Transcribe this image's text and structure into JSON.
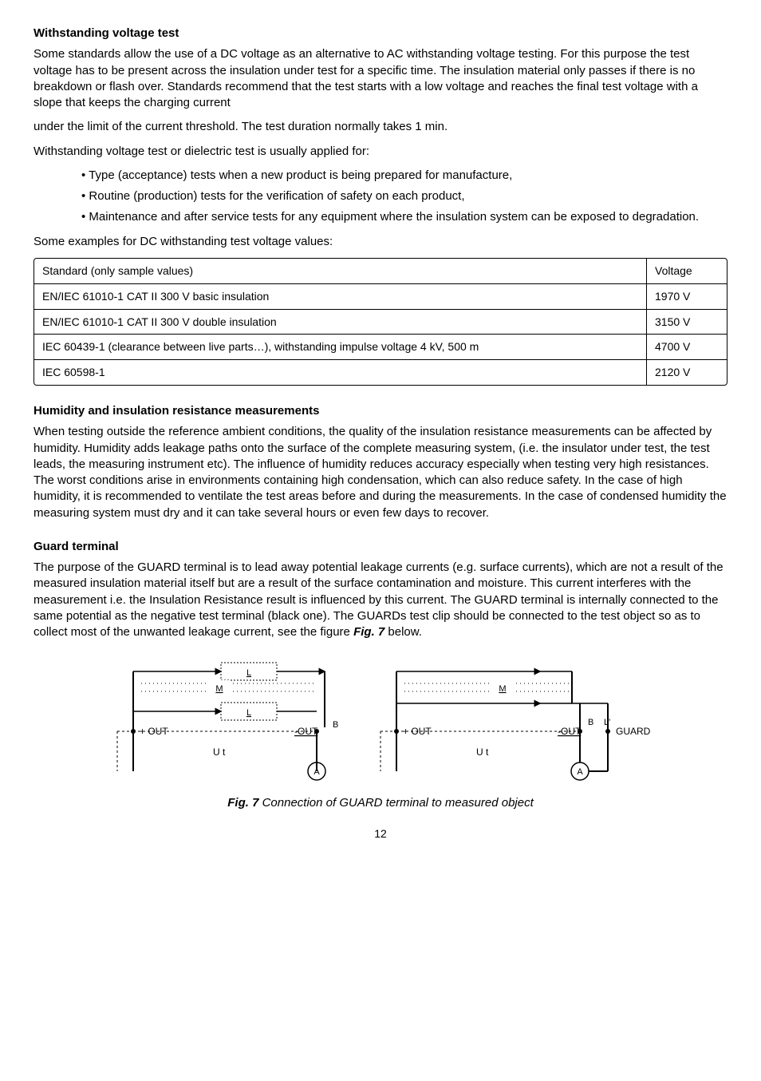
{
  "section1": {
    "heading": "Withstanding voltage test",
    "p1": "Some standards allow the use of a DC voltage as an alternative to AC withstanding voltage testing. For this purpose the test voltage has to be present across the insulation under test for a specific time. The insulation material only passes if there is no breakdown or flash over. Standards recommend that the test starts with a low voltage and reaches the final test voltage with a slope that keeps the charging current",
    "p2": "under the limit of the current threshold. The test duration normally takes 1 min.",
    "p3": "Withstanding voltage test or dielectric test is usually applied for:",
    "bullets": [
      "Type (acceptance) tests when a new product is being prepared for manufacture,",
      "Routine (production) tests for the verification of safety on each product,",
      "Maintenance and after service tests for any equipment where the insulation system can be exposed to degradation."
    ],
    "p4": "Some examples for DC withstanding test voltage values:"
  },
  "table": {
    "rows": [
      {
        "standard": "Standard (only sample values)",
        "voltage": "Voltage"
      },
      {
        "standard": "EN/IEC 61010-1 CAT II 300 V basic insulation",
        "voltage": "1970 V"
      },
      {
        "standard": "EN/IEC 61010-1 CAT II 300 V double insulation",
        "voltage": "3150 V"
      },
      {
        "standard": "IEC 60439-1 (clearance between live parts…), withstanding impulse voltage 4 kV, 500 m",
        "voltage": "4700 V"
      },
      {
        "standard": "IEC 60598-1",
        "voltage": "2120 V"
      }
    ]
  },
  "section2": {
    "heading": "Humidity and insulation resistance measurements",
    "p": "When testing outside the reference ambient conditions, the quality of the insulation resistance measurements can be affected by humidity. Humidity adds leakage paths onto the surface of the complete measuring system, (i.e. the insulator under test, the test leads, the measuring instrument etc). The influence of humidity reduces accuracy especially when testing very high resistances. The worst conditions arise in environments containing high condensation, which can also reduce safety. In the case of high humidity, it is recommended to ventilate the test areas before and during the measurements. In the case of condensed humidity the measuring system must dry and it can take several hours or even few days to recover."
  },
  "section3": {
    "heading": "Guard terminal",
    "p1a": "The purpose of the GUARD terminal is to lead away potential leakage currents (e.g. surface currents), which are not a result of the measured insulation material itself but are a result of the surface contamination and moisture. This current interferes with the measurement i.e. the Insulation Resistance result is influenced by this current. The GUARD terminal is internally connected to the same potential as the negative test terminal (black one). The GUARDs test clip should be connected to the test object so as to collect most of the unwanted leakage current, see the figure ",
    "figref": "Fig. 7",
    "p1b": " below."
  },
  "figure": {
    "label": "Fig. 7",
    "caption": "  Connection of GUARD terminal to measured object",
    "labels": {
      "plusout": "+ OUT",
      "minusout": "-OUT",
      "guard": "GUARD",
      "ut": "U t",
      "L": "L",
      "M": "M",
      "A": "A",
      "B": "B"
    }
  },
  "pagenum": "12"
}
